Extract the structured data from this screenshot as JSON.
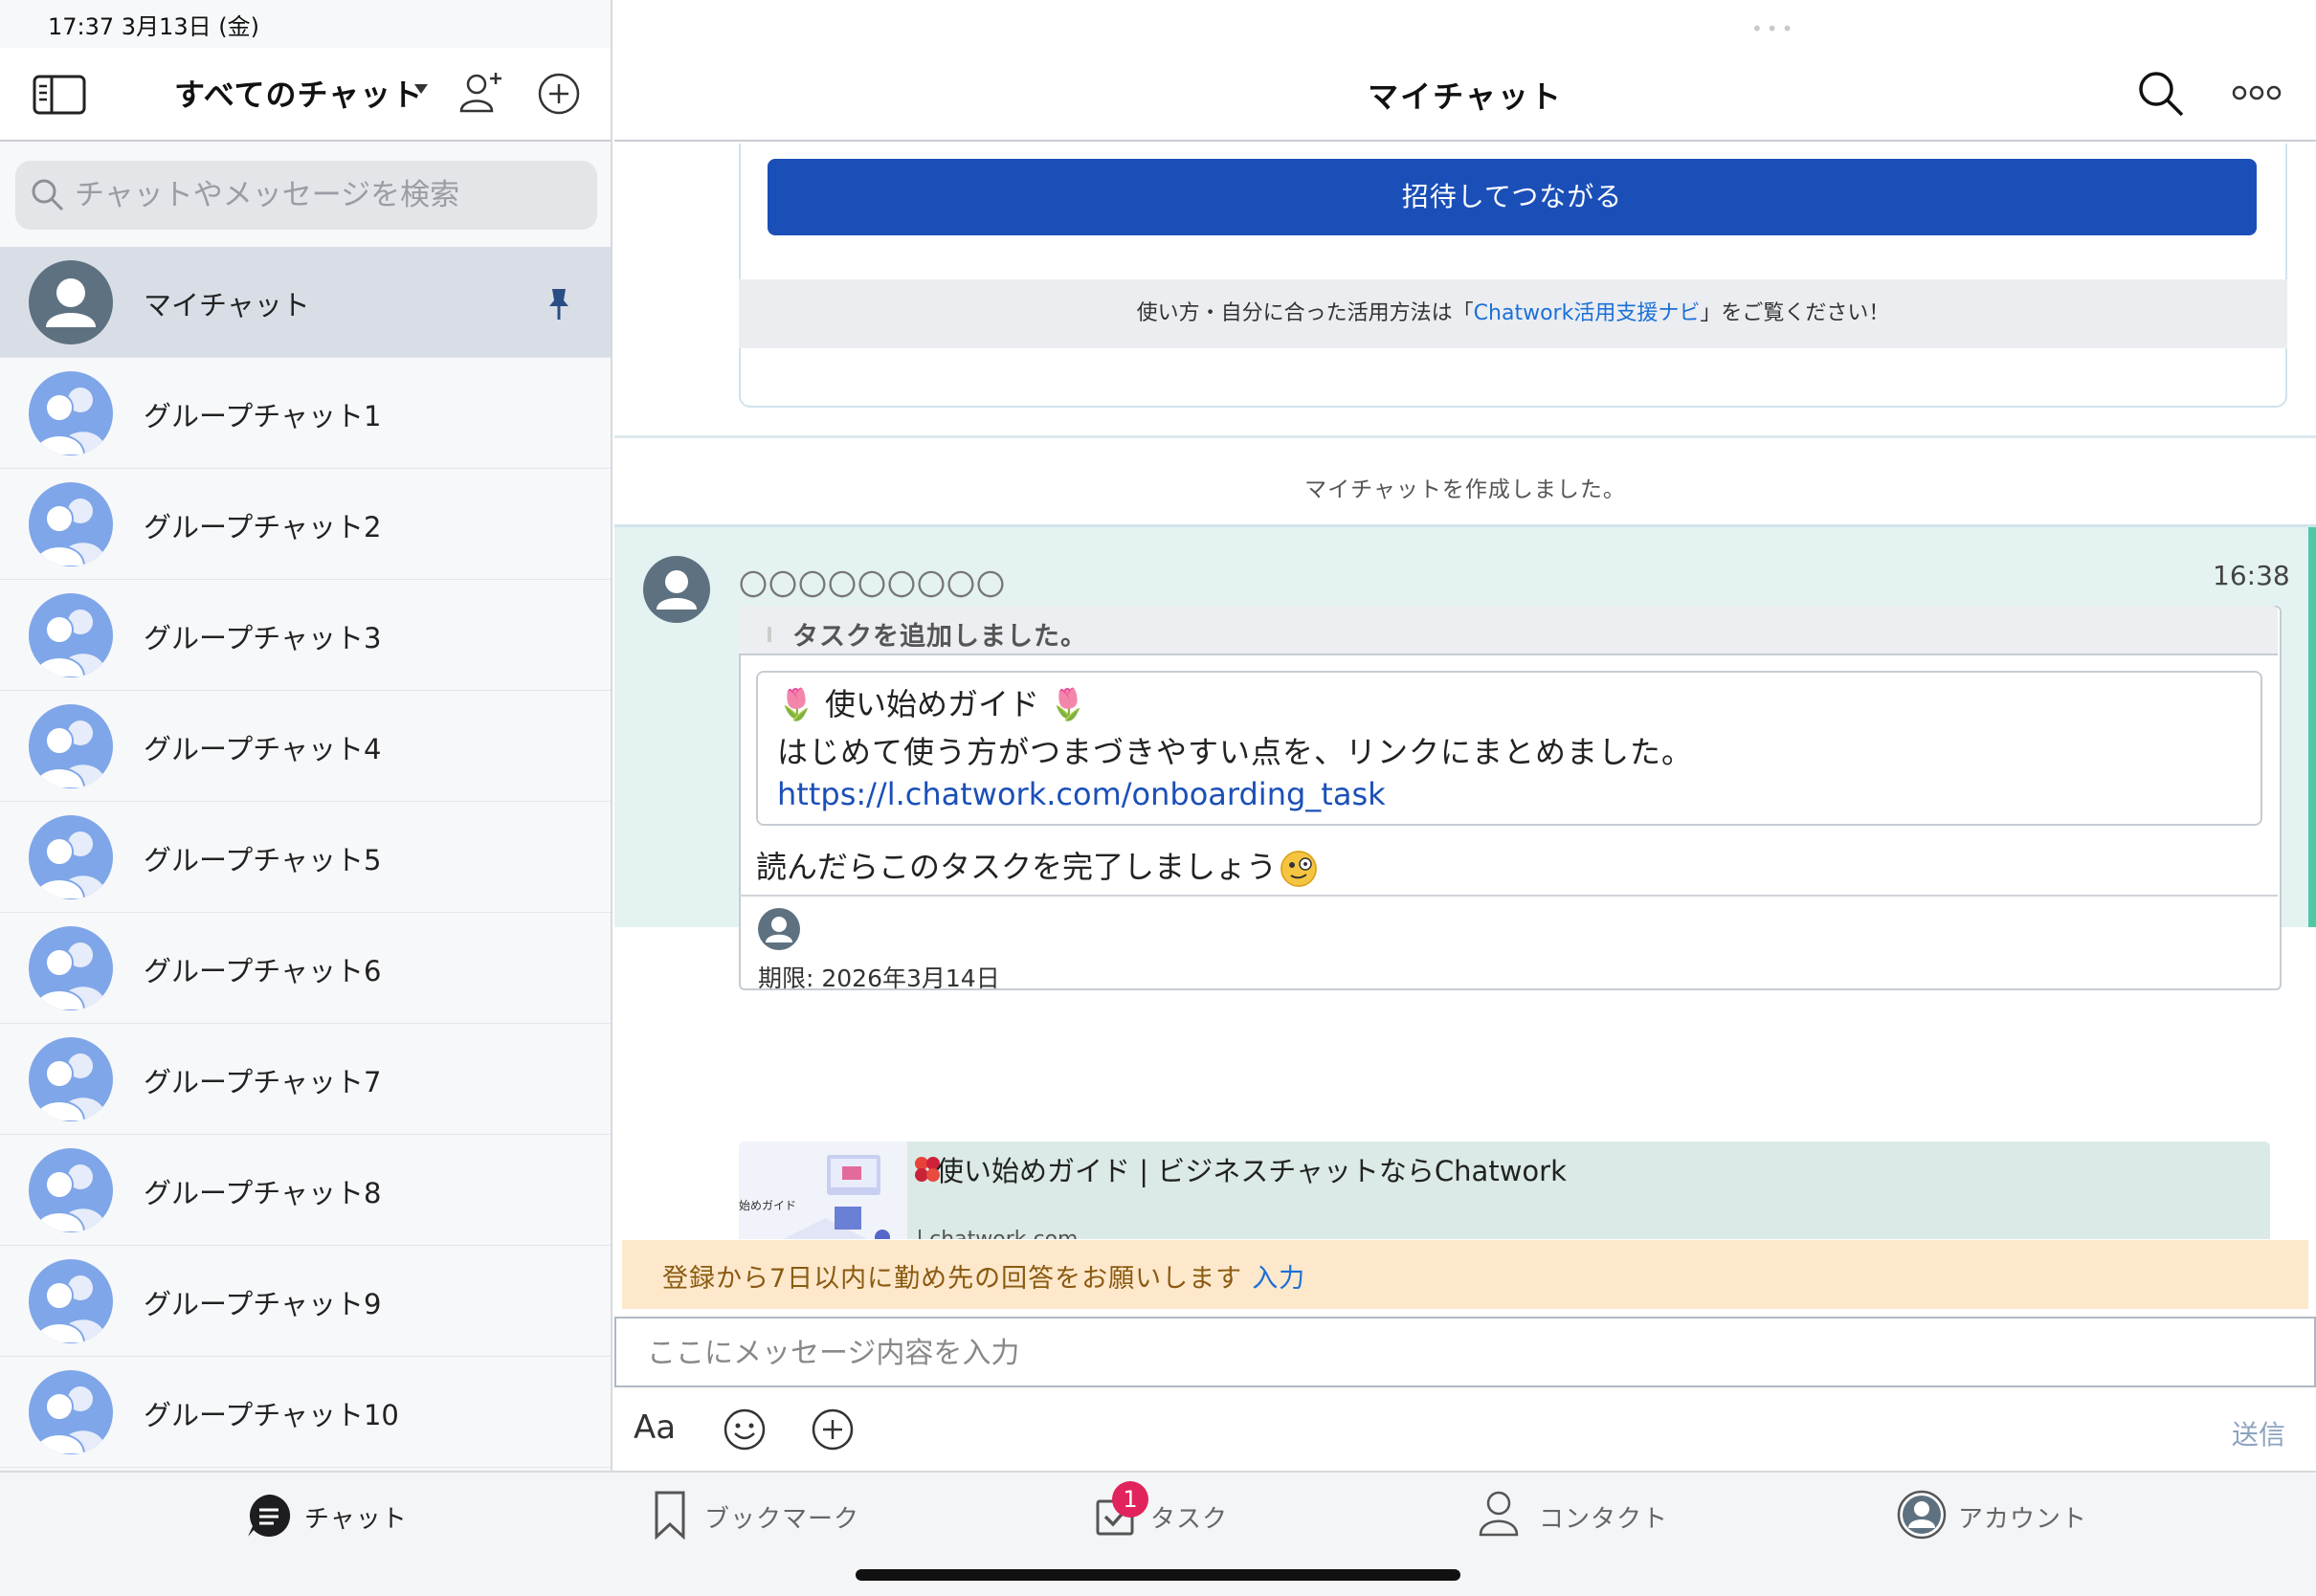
{
  "status_bar": {
    "time_date": "17:37   3月13日 (金)"
  },
  "left_header": {
    "title": "すべてのチャット"
  },
  "search": {
    "placeholder": "チャットやメッセージを検索"
  },
  "chats": [
    {
      "name": "マイチャット",
      "pinned": true,
      "active": true
    },
    {
      "name": "グループチャット1"
    },
    {
      "name": "グループチャット2"
    },
    {
      "name": "グループチャット3"
    },
    {
      "name": "グループチャット4"
    },
    {
      "name": "グループチャット5"
    },
    {
      "name": "グループチャット6"
    },
    {
      "name": "グループチャット7"
    },
    {
      "name": "グループチャット8"
    },
    {
      "name": "グループチャット9"
    },
    {
      "name": "グループチャット10"
    }
  ],
  "right_header": {
    "title": "マイチャット"
  },
  "intro": {
    "invite_button": "招待してつながる",
    "help_prefix": "使い方・自分に合った活用方法は「",
    "help_link": "Chatwork活用支援ナビ",
    "help_suffix": "」をご覧ください！"
  },
  "system_message": "マイチャットを作成しました。",
  "message": {
    "sender": "〇〇〇〇〇〇〇〇〇",
    "time": "16:38",
    "task_header": "タスクを追加しました。",
    "quote_title": "🌷 使い始めガイド 🌷",
    "quote_body": "はじめて使う方がつまづきやすい点を、リンクにまとめました。",
    "quote_link": "https://l.chatwork.com/onboarding_task",
    "task_text": "読んだらこのタスクを完了しましょう",
    "due": "期限: 2026年3月14日",
    "preview_title": "使い始めガイド | ビジネスチャットならChatwork",
    "preview_url": "l.chatwork.com",
    "preview_thumb_text": "始めガイド"
  },
  "notice": {
    "text": "登録から7日以内に勤め先の回答をお願いします",
    "link": "入力"
  },
  "composer": {
    "placeholder": "ここにメッセージ内容を入力",
    "format_label": "Aa",
    "send_label": "送信"
  },
  "tabs": [
    {
      "label": "チャット",
      "icon": "chat-bubble-icon",
      "active": true
    },
    {
      "label": "ブックマーク",
      "icon": "bookmark-icon"
    },
    {
      "label": "タスク",
      "icon": "task-checkbox-icon",
      "badge": "1"
    },
    {
      "label": "コンタクト",
      "icon": "contact-person-icon"
    },
    {
      "label": "アカウント",
      "icon": "account-avatar-icon"
    }
  ],
  "colors": {
    "primary": "#1b4fb8",
    "link": "#1b6fd8",
    "message_bg": "#e4f3f1",
    "accent_bar": "#4fc8a6",
    "notice_bg": "#fde8cc",
    "badge": "#e2245c"
  }
}
